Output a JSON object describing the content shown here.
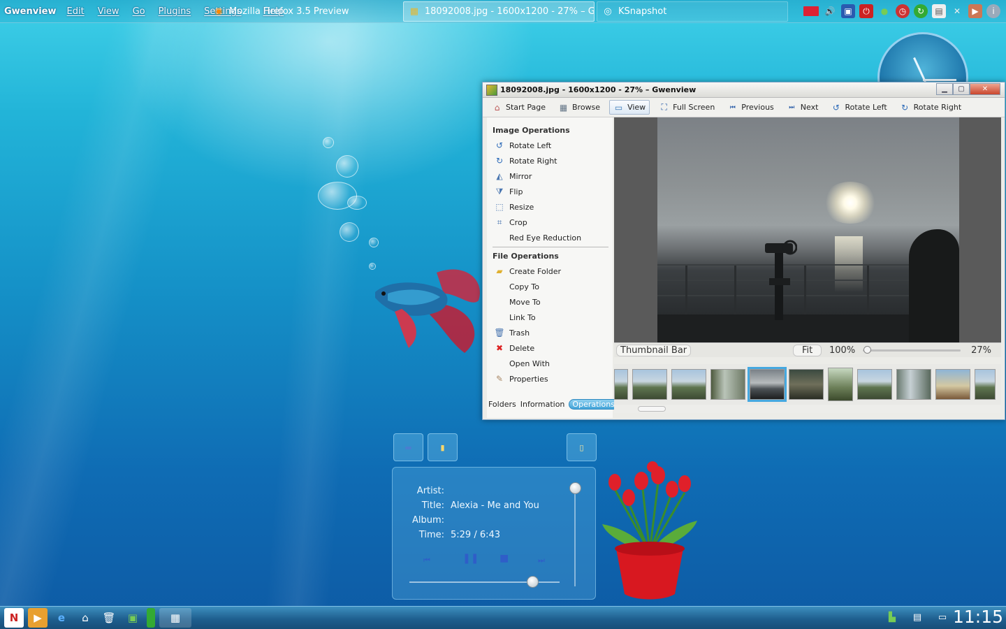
{
  "menubar": {
    "app_name": "Gwenview",
    "items": [
      "Edit",
      "View",
      "Go",
      "Plugins",
      "Settings",
      "Help"
    ]
  },
  "gwenview": {
    "title": "18092008.jpg - 1600x1200 - 27% – Gwenview",
    "toolbar": {
      "start_page": "Start Page",
      "browse": "Browse",
      "view": "View",
      "full_screen": "Full Screen",
      "previous": "Previous",
      "next": "Next",
      "rotate_left": "Rotate Left",
      "rotate_right": "Rotate Right"
    },
    "image_operations": {
      "heading": "Image Operations",
      "items": [
        "Rotate Left",
        "Rotate Right",
        "Mirror",
        "Flip",
        "Resize",
        "Crop",
        "Red Eye Reduction"
      ]
    },
    "file_operations": {
      "heading": "File Operations",
      "items": [
        "Create Folder",
        "Copy To",
        "Move To",
        "Link To",
        "Trash",
        "Delete",
        "Open With",
        "Properties"
      ]
    },
    "sidebar_tabs": [
      "Folders",
      "Information",
      "Operations"
    ],
    "zoombar": {
      "thumbnail_bar": "Thumbnail Bar",
      "fit": "Fit",
      "hundred": "100%",
      "zoom": "27%",
      "zoom_level": 0.27
    }
  },
  "player": {
    "artist_label": "Artist:",
    "artist_value": "",
    "title_label": "Title:",
    "title_value": "Alexia - Me and You",
    "album_label": "Album:",
    "album_value": "",
    "time_label": "Time:",
    "time_value": "5:29 / 6:43",
    "progress": 0.82
  },
  "taskbar": {
    "tasks": [
      "Mozilla Firefox 3.5 Preview",
      "18092008.jpg - 1600x1200 - 27% – G",
      "KSnapshot"
    ],
    "clock": "11:15"
  },
  "colors": {
    "selection": "#45a8e0",
    "desktop_top": "#3fd0e8",
    "desktop_bottom": "#0d5aa4"
  }
}
